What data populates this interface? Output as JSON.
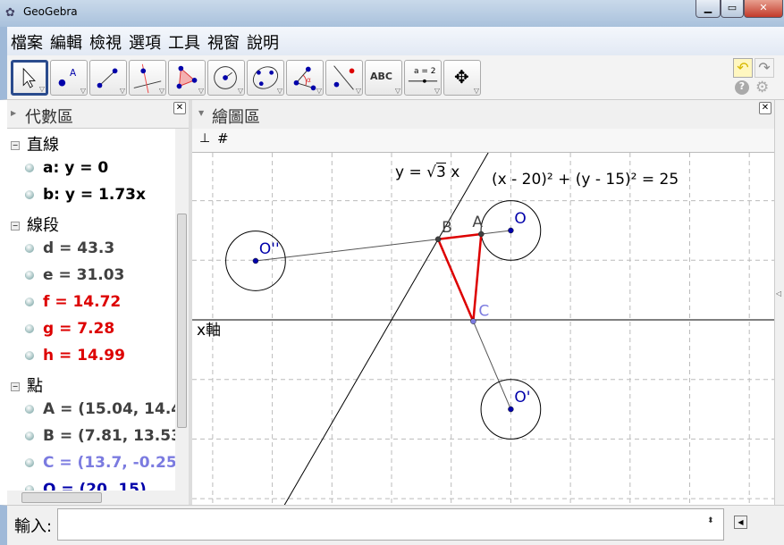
{
  "window": {
    "title": "GeoGebra"
  },
  "menu": [
    "檔案",
    "編輯",
    "檢視",
    "選項",
    "工具",
    "視窗",
    "說明"
  ],
  "toolbar": {
    "tools": [
      "move-tool",
      "point-tool",
      "line-tool",
      "perpendicular-tool",
      "polygon-tool",
      "circle-center-point-tool",
      "conic-five-points-tool",
      "angle-tool",
      "reflect-tool",
      "text-tool",
      "slider-tool",
      "move-graphics-tool"
    ],
    "text_label": "ABC",
    "slider_label": "a = 2"
  },
  "algebra": {
    "title": "代數區",
    "categories": [
      {
        "label": "直線",
        "items": [
          {
            "text": "a: y = 0",
            "color": "#000000"
          },
          {
            "text": "b: y = 1.73x",
            "color": "#000000"
          }
        ]
      },
      {
        "label": "線段",
        "items": [
          {
            "text": "d = 43.3",
            "color": "#404040"
          },
          {
            "text": "e = 31.03",
            "color": "#404040"
          },
          {
            "text": "f = 14.72",
            "color": "#dd0000"
          },
          {
            "text": "g = 7.28",
            "color": "#dd0000"
          },
          {
            "text": "h = 14.99",
            "color": "#dd0000"
          }
        ]
      },
      {
        "label": "點",
        "items": [
          {
            "text": "A = (15.04, 14.4",
            "color": "#404040"
          },
          {
            "text": "B = (7.81, 13.53",
            "color": "#404040"
          },
          {
            "text": "C = (13.7, -0.25",
            "color": "#7b7be0"
          },
          {
            "text": "O = (20, 15)",
            "color": "#0000aa"
          }
        ]
      }
    ]
  },
  "graphics": {
    "title": "繪圖區",
    "axis_label": "x軸",
    "line_label_prefix": "y = ",
    "line_label_sqrt": "3",
    "line_label_suffix": " x",
    "circle_equation": "(x - 20)² + (y - 15)² = 25",
    "points": {
      "A": [
        15.04,
        14.4
      ],
      "B": [
        7.81,
        13.53
      ],
      "C": [
        13.7,
        -0.25
      ],
      "O": [
        20,
        15
      ],
      "O'": [
        20,
        -15
      ],
      "O''": [
        -22.8,
        9.9
      ]
    },
    "line_slope": 1.73,
    "circle_radius": 5,
    "grid_step": 10,
    "colors": {
      "triangle": "#dd0000",
      "point_dark": "#404040",
      "point_blue": "#0000aa",
      "point_c": "#7b7be0"
    }
  },
  "input": {
    "label": "輸入:",
    "value": ""
  }
}
